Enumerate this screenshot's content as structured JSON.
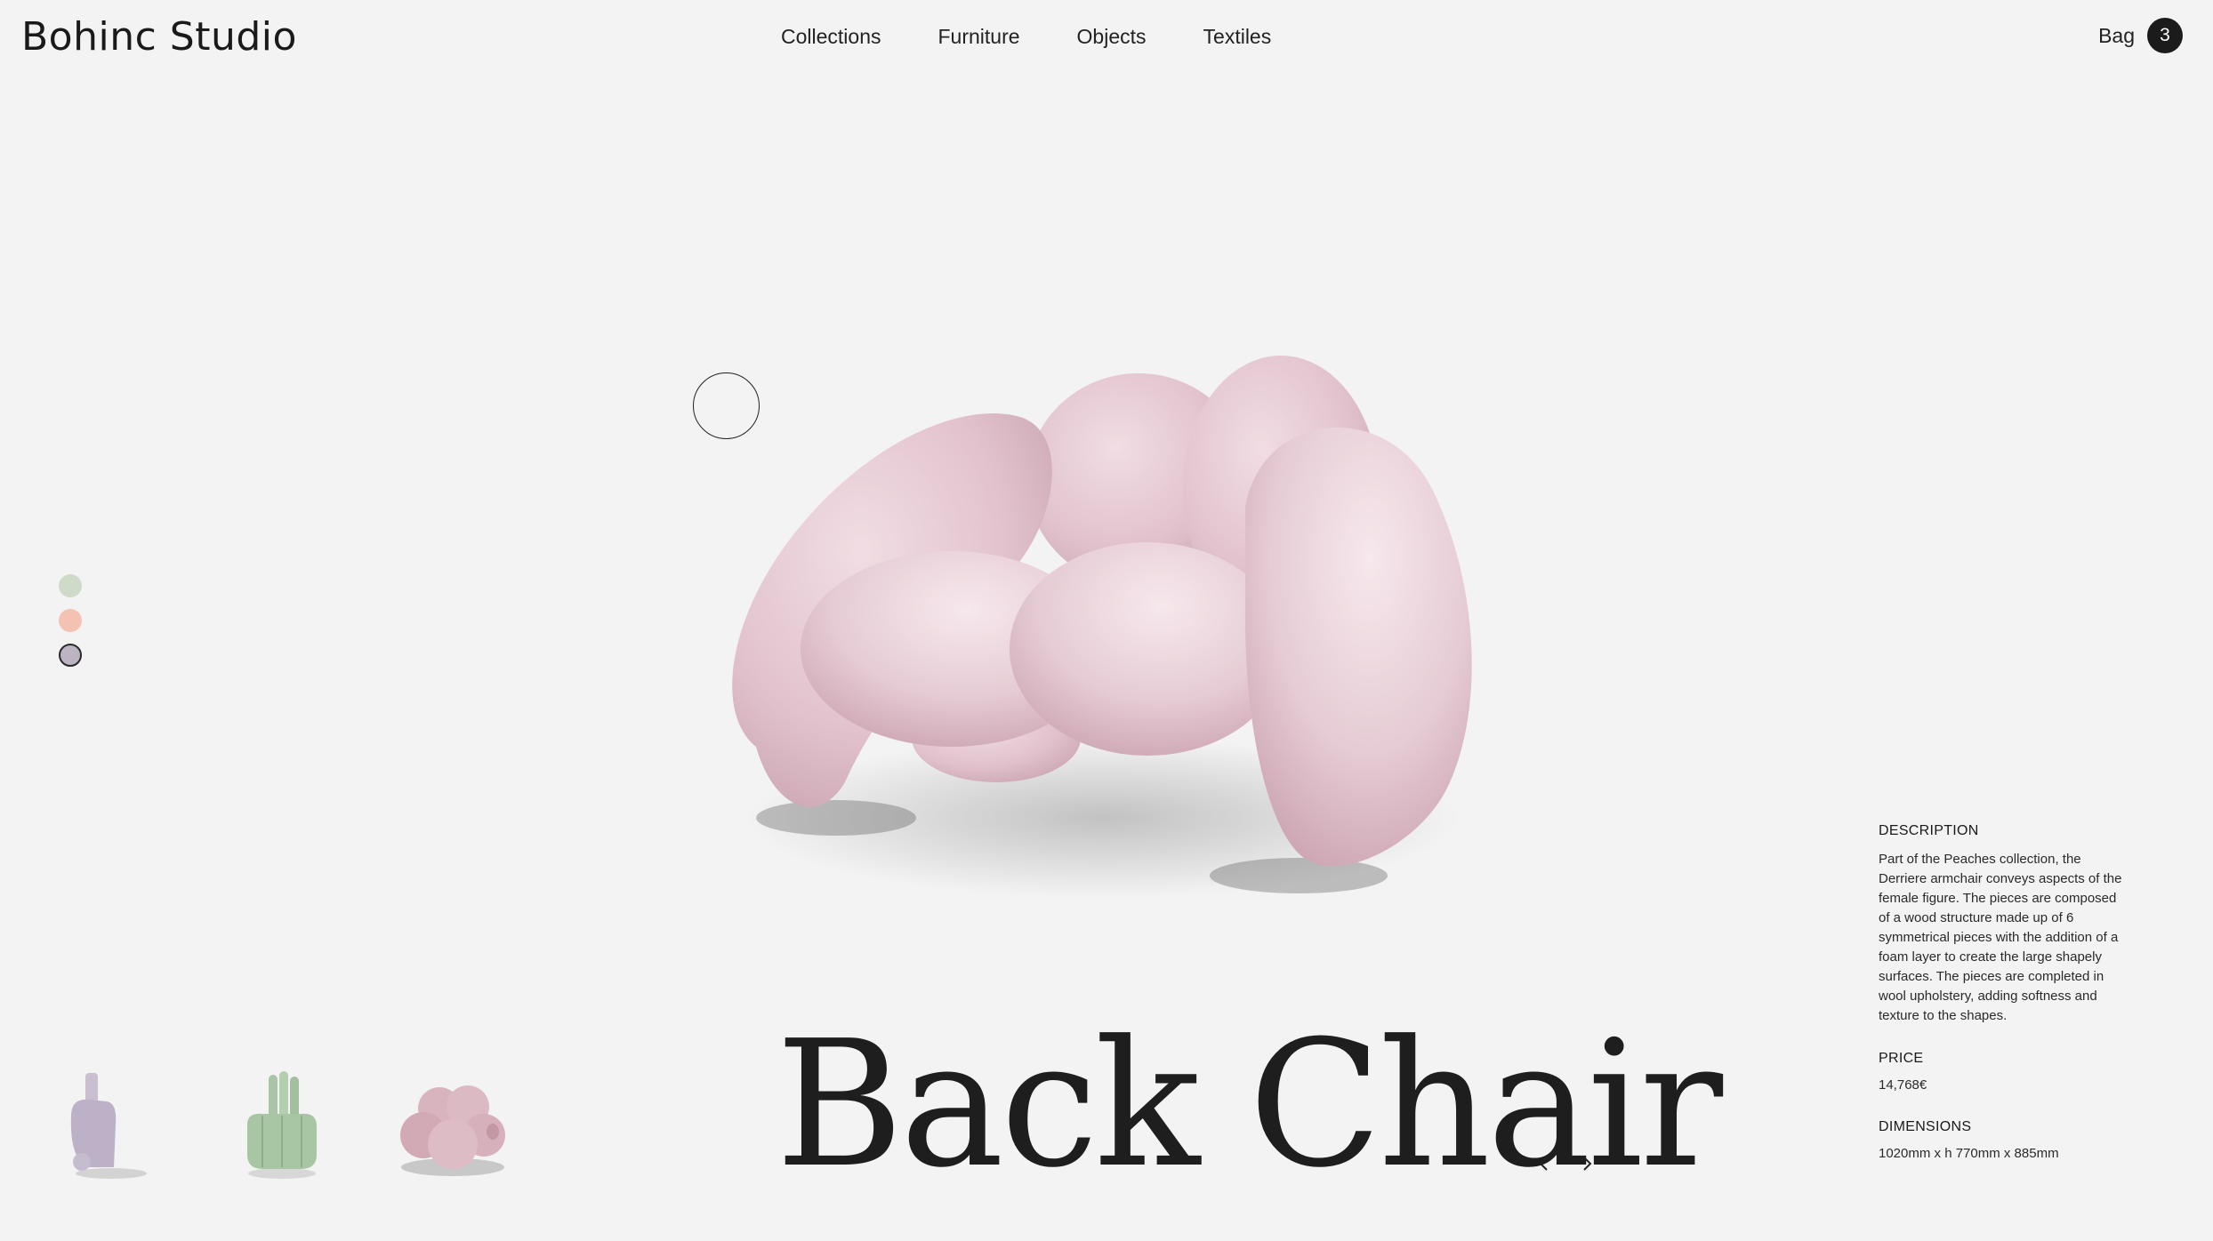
{
  "header": {
    "logo": "Bohinc Studio",
    "nav": [
      "Collections",
      "Furniture",
      "Objects",
      "Textiles"
    ],
    "bag_label": "Bag",
    "bag_count": "3"
  },
  "swatches": [
    {
      "name": "sage",
      "color": "#cfdbc8"
    },
    {
      "name": "peach",
      "color": "#f4c2b3"
    },
    {
      "name": "lilac",
      "color": "#bcb3c3",
      "selected": true
    }
  ],
  "thumbnails": [
    "lilac-vase-icon",
    "green-stacked-vase-icon",
    "pink-armchair-icon"
  ],
  "product": {
    "title": "Back Chair",
    "description_label": "DESCRIPTION",
    "description": "Part of the Peaches collection, the Derriere armchair conveys aspects of the female figure. The pieces are composed of a wood structure made up of 6 symmetrical pieces with the addition of a foam layer to create the large shapely surfaces. The pieces are completed in wool upholstery, adding softness and texture to the shapes.",
    "price_label": "PRICE",
    "price": "14,768€",
    "dimensions_label": "DIMENSIONS",
    "dimensions": "1020mm x h 770mm x 885mm"
  },
  "colors": {
    "background": "#f3f3f3",
    "text": "#1d1d1d",
    "chair_pink": "#e3c5cf"
  }
}
